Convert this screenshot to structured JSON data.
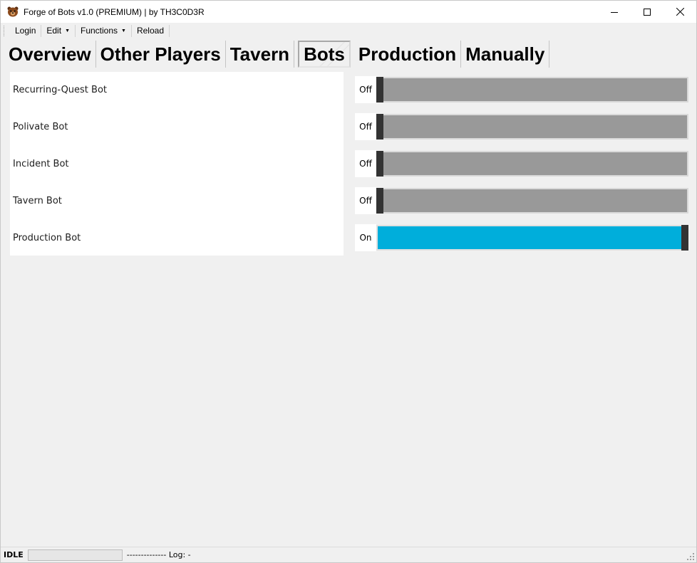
{
  "window": {
    "title": "Forge of Bots v1.0 (PREMIUM) | by TH3C0D3R",
    "icon": "bear-app-icon",
    "controls": [
      "minimize",
      "maximize",
      "close"
    ]
  },
  "menu": {
    "login": "Login",
    "edit": "Edit",
    "functions": "Functions",
    "reload": "Reload"
  },
  "tabs": [
    {
      "label": "Overview",
      "active": false
    },
    {
      "label": "Other Players",
      "active": false
    },
    {
      "label": "Tavern",
      "active": false
    },
    {
      "label": "Bots",
      "active": true
    },
    {
      "label": "Production",
      "active": false
    },
    {
      "label": "Manually",
      "active": false
    }
  ],
  "bots": [
    {
      "label": "Recurring-Quest Bot",
      "state": "Off"
    },
    {
      "label": "Polivate Bot",
      "state": "Off"
    },
    {
      "label": "Incident Bot",
      "state": "Off"
    },
    {
      "label": "Tavern Bot",
      "state": "Off"
    },
    {
      "label": "Production Bot",
      "state": "On"
    }
  ],
  "colors": {
    "toggle_on": "#00aedb",
    "toggle_off": "#999999",
    "knob": "#333333"
  },
  "status": {
    "state": "IDLE",
    "log_text": "-------------- Log:  -"
  }
}
